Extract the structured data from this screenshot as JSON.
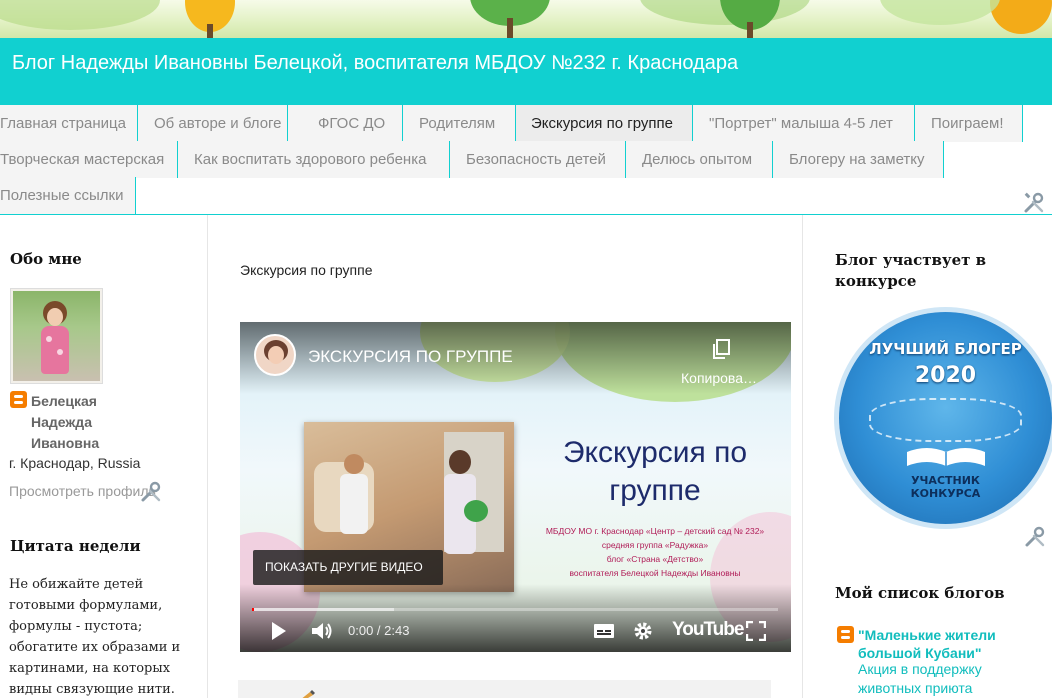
{
  "header": {
    "title": "Блог Надежды Ивановны Белецкой, воспитателя МБДОУ №232 г. Краснодара"
  },
  "nav": {
    "tabs": [
      {
        "label": "Главная страница"
      },
      {
        "label": "Об авторе и блоге"
      },
      {
        "label": "ФГОС ДО"
      },
      {
        "label": "Родителям"
      },
      {
        "label": "Экскурсия по группе",
        "active": true
      },
      {
        "label": "\"Портрет\" малыша 4-5 лет"
      },
      {
        "label": "Поиграем!"
      },
      {
        "label": "Творческая мастерская"
      },
      {
        "label": "Как воспитать здорового ребенка"
      },
      {
        "label": "Безопасность детей"
      },
      {
        "label": "Делюсь опытом"
      },
      {
        "label": "Блогеру на заметку"
      },
      {
        "label": "Полезные ссылки"
      }
    ]
  },
  "about": {
    "title": "Обо мне",
    "name": "Белецкая Надежда Ивановна",
    "location": "г. Краснодар, Russia",
    "profile_link": "Просмотреть профиль"
  },
  "quote": {
    "title": "Цитата недели",
    "text": "Не обижайте детей готовыми формулами, формулы - пустота; обогатите их образами и картинами, на которых видны связующие нити."
  },
  "post": {
    "title": "Экскурсия по группе"
  },
  "video": {
    "title": "ЭКСКУРСИЯ ПО ГРУППЕ",
    "copy_label": "Копирова…",
    "overlay_heading_line1": "Экскурсия по",
    "overlay_heading_line2": "группе",
    "caption_line1": "МБДОУ МО г. Краснодар «Центр – детский сад № 232»",
    "caption_line2": "средняя группа «Радужка»",
    "caption_line3": "блог «Страна «Детство»",
    "caption_line4": "воспитателя Белецкой Надежды Ивановны",
    "more_videos_label": "ПОКАЗАТЬ ДРУГИЕ ВИДЕО",
    "time": "0:00 / 2:43",
    "brand": "YouTube",
    "progress": 0.0,
    "buffered": 0.27
  },
  "contest": {
    "title": "Блог участвует в конкурсе",
    "badge_top": "ЛУЧШИЙ БЛОГЕР",
    "badge_year": "2020",
    "badge_bottom_line1": "УЧАСТНИК",
    "badge_bottom_line2": "КОНКУРСА"
  },
  "bloglist": {
    "title": "Мой список блогов",
    "items": [
      {
        "name": "\"Маленькие жители большой Кубани\"",
        "latest": "Акция в поддержку животных приюта"
      }
    ]
  },
  "colors": {
    "header_bg": "#11d0d0",
    "link": "#11bdbd",
    "blogger_orange": "#f57d00"
  },
  "icons": {
    "edit": "wrench-screwdriver-icon",
    "blogger": "blogger-icon",
    "play": "play-icon",
    "volume": "volume-icon",
    "subtitles": "subtitles-icon",
    "settings": "gear-icon",
    "fullscreen": "fullscreen-icon",
    "copy": "copy-icon"
  }
}
